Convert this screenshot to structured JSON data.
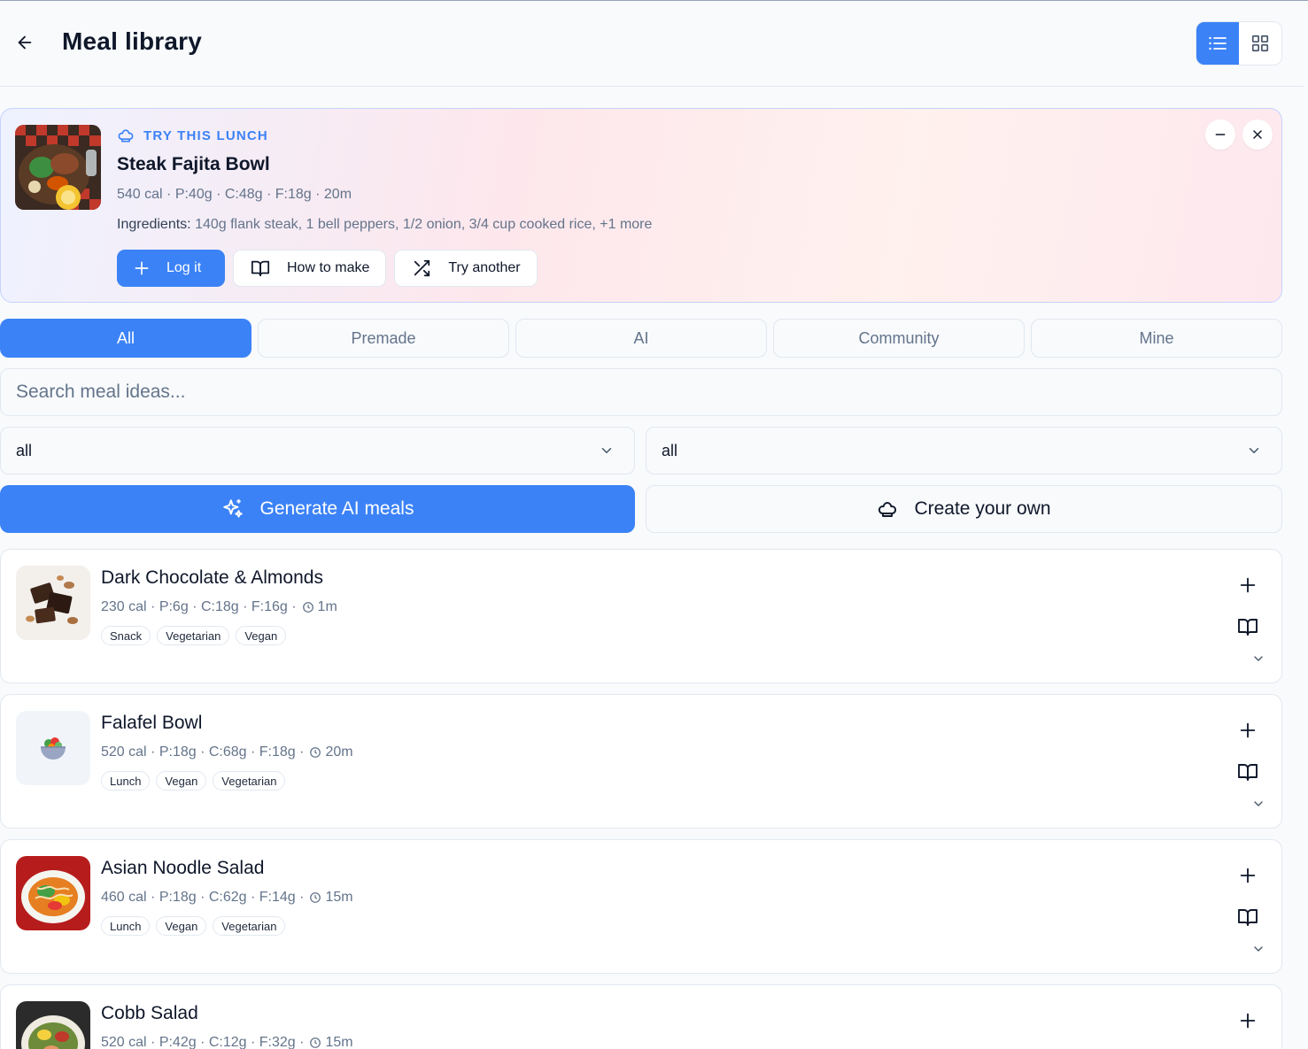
{
  "header": {
    "title": "Meal library",
    "accent": "#3b82f6"
  },
  "suggestion": {
    "kicker": "TRY THIS LUNCH",
    "title": "Steak Fajita Bowl",
    "meta": "540 cal · P:40g · C:48g · F:18g · 20m",
    "ingredients_label": "Ingredients:",
    "ingredients": "140g flank steak, 1 bell peppers, 1/2 onion, 3/4 cup cooked rice, +1 more",
    "actions": {
      "log": "Log it",
      "how": "How to make",
      "another": "Try another"
    }
  },
  "tabs": [
    {
      "label": "All",
      "active": true
    },
    {
      "label": "Premade",
      "active": false
    },
    {
      "label": "AI",
      "active": false
    },
    {
      "label": "Community",
      "active": false
    },
    {
      "label": "Mine",
      "active": false
    }
  ],
  "search": {
    "placeholder": "Search meal ideas...",
    "value": ""
  },
  "filters": {
    "left": "all",
    "right": "all"
  },
  "buttons": {
    "generate": "Generate AI meals",
    "create": "Create your own"
  },
  "meals": [
    {
      "name": "Dark Chocolate & Almonds",
      "meta": "230 cal · P:6g · C:18g · F:16g ·",
      "time": "1m",
      "tags": [
        "Snack",
        "Vegetarian",
        "Vegan"
      ]
    },
    {
      "name": "Falafel Bowl",
      "meta": "520 cal · P:18g · C:68g · F:18g ·",
      "time": "20m",
      "tags": [
        "Lunch",
        "Vegan",
        "Vegetarian"
      ]
    },
    {
      "name": "Asian Noodle Salad",
      "meta": "460 cal · P:18g · C:62g · F:14g ·",
      "time": "15m",
      "tags": [
        "Lunch",
        "Vegan",
        "Vegetarian"
      ]
    },
    {
      "name": "Cobb Salad",
      "meta": "520 cal · P:42g · C:12g · F:32g ·",
      "time": "15m",
      "tags": []
    }
  ]
}
